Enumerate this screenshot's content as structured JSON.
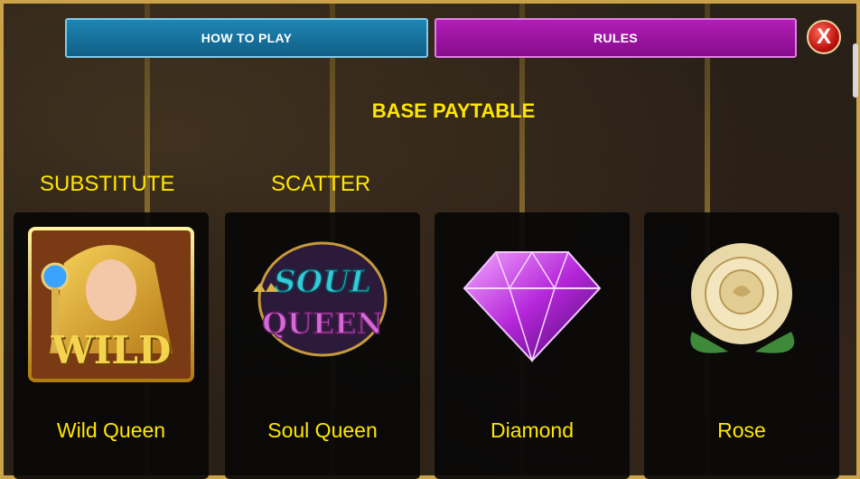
{
  "tabs": {
    "how_to_play": "HOW TO PLAY",
    "rules": "RULES"
  },
  "close_label": "X",
  "heading": "BASE PAYTABLE",
  "labels": {
    "substitute": "SUBSTITUTE",
    "scatter": "SCATTER"
  },
  "symbols": [
    {
      "name": "Wild Queen",
      "icon": "wild-queen-icon",
      "badge": "WILD"
    },
    {
      "name": "Soul Queen",
      "icon": "soul-queen-logo-icon",
      "logo_line1": "SOUL",
      "logo_line2": "QUEEN"
    },
    {
      "name": "Diamond",
      "icon": "diamond-icon"
    },
    {
      "name": "Rose",
      "icon": "rose-icon"
    }
  ],
  "colors": {
    "accent_yellow": "#ffe600",
    "tab_blue": "#1f86b4",
    "tab_purple": "#b21eb6",
    "close_red": "#c0140e",
    "frame_gold": "#caa24a"
  }
}
